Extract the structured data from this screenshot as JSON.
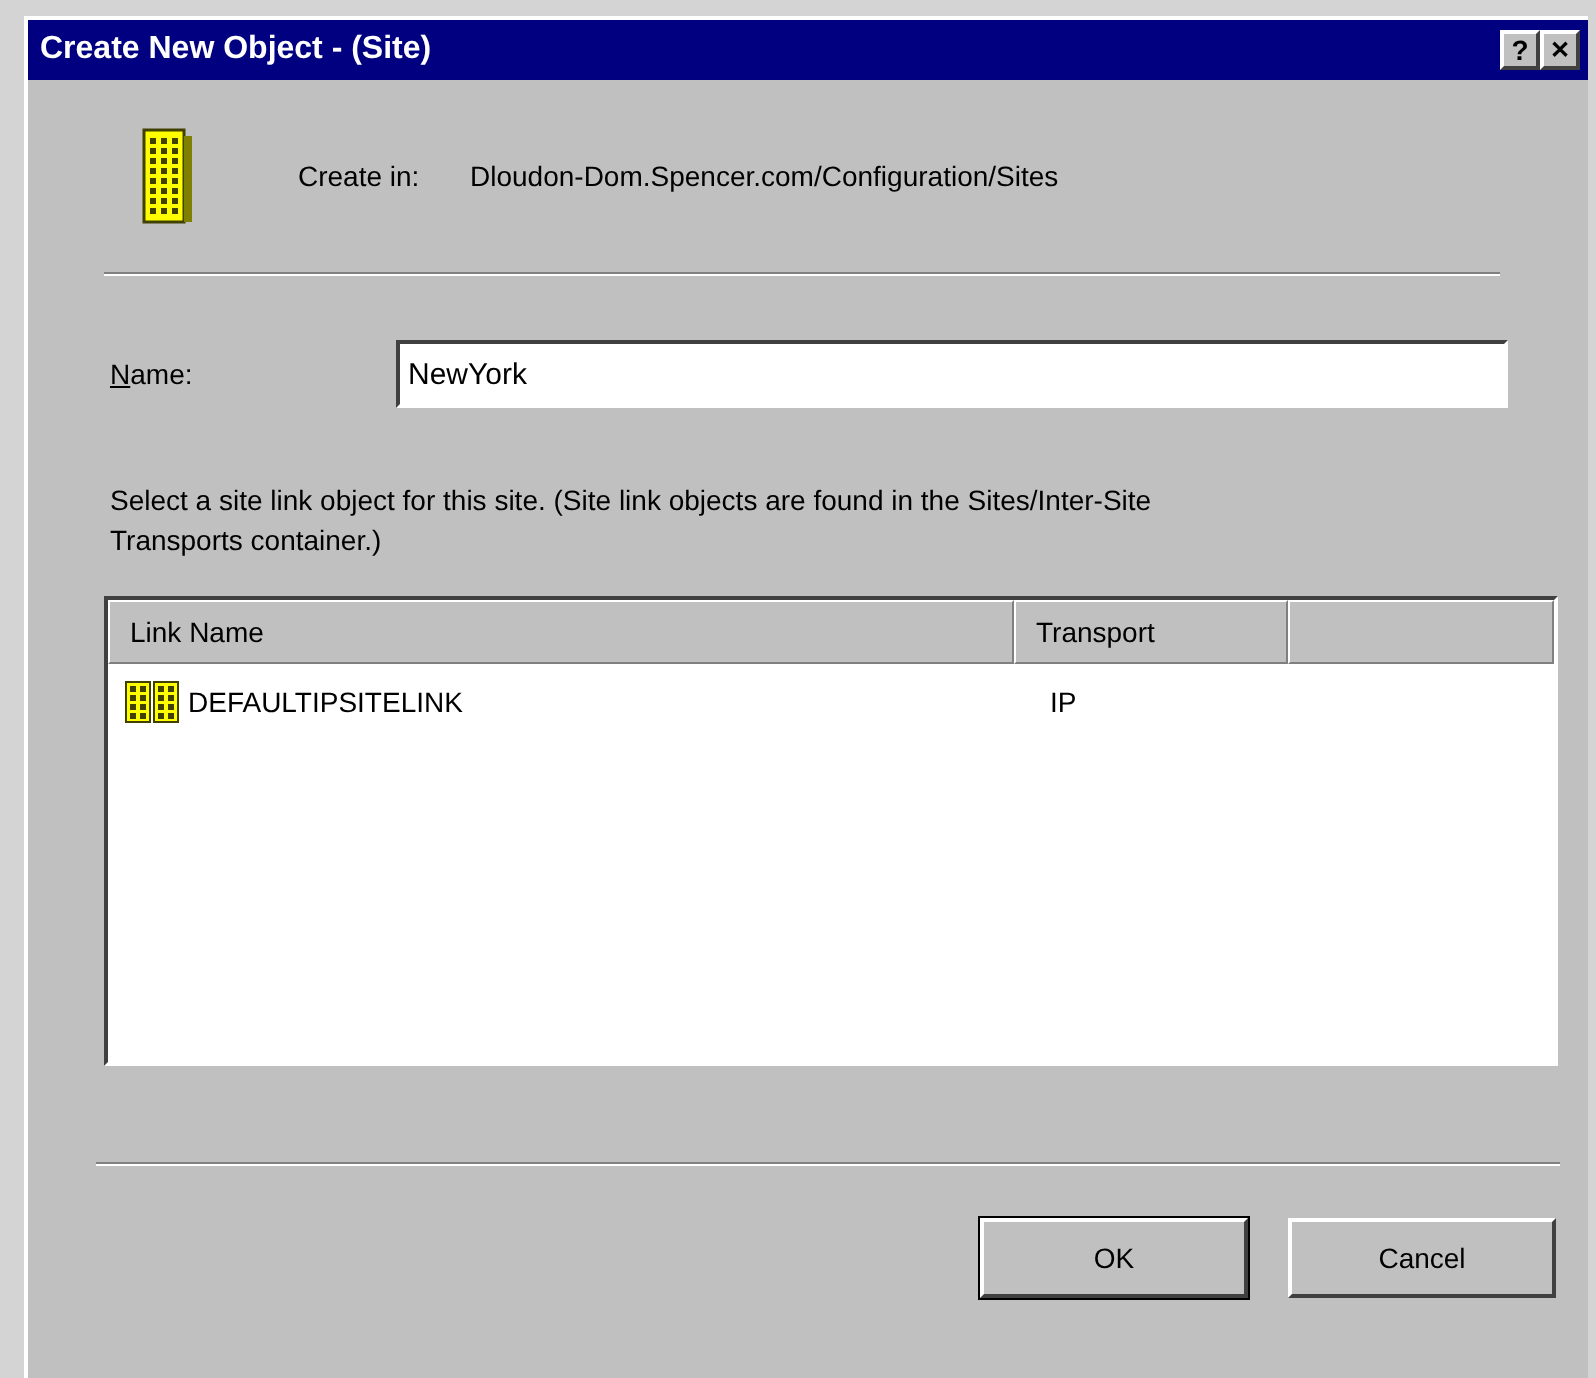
{
  "window": {
    "title": "Create New Object - (Site)",
    "controls": [
      {
        "kind": "help",
        "label": "?"
      },
      {
        "kind": "close",
        "label": "✕"
      }
    ]
  },
  "create_in": {
    "label": "Create in:",
    "path": "Dloudon-Dom.Spencer.com/Configuration/Sites"
  },
  "name_field": {
    "label": "Name:",
    "value": "NewYork"
  },
  "instructions": "Select a site link object for this site.  (Site link objects are found in the Sites/Inter-Site Transports container.)",
  "table": {
    "columns": [
      "Link Name",
      "Transport"
    ],
    "rows": [
      {
        "cells": [
          "DEFAULTIPSITELINK",
          "IP"
        ],
        "selected": false
      }
    ]
  },
  "buttons": [
    {
      "label": "OK",
      "default": true
    },
    {
      "label": "Cancel",
      "default": false
    }
  ]
}
